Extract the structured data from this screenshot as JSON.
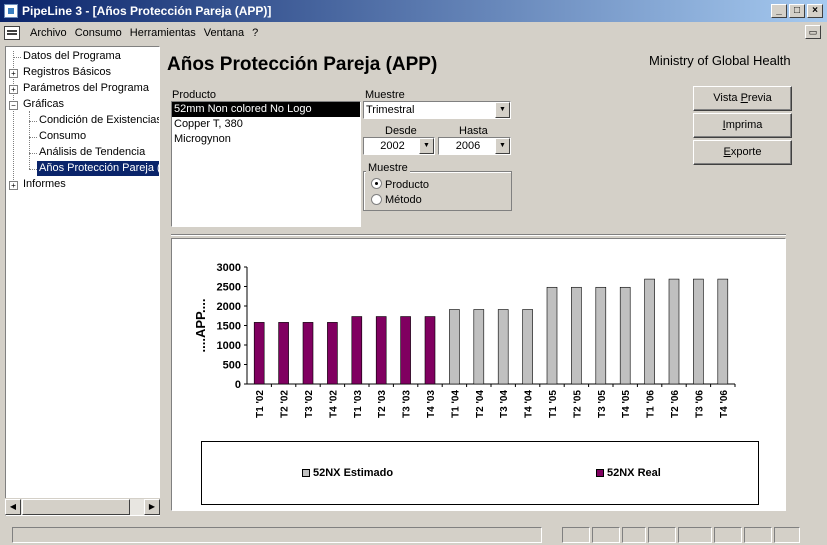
{
  "window": {
    "title": "PipeLine 3 - [Años Protección Pareja (APP)]",
    "min": "_",
    "max": "□",
    "close": "×",
    "restore": "🗗"
  },
  "menu": {
    "archivo": "Archivo",
    "consumo": "Consumo",
    "herramientas": "Herramientas",
    "ventana": "Ventana",
    "help": "?"
  },
  "tree": {
    "datos": "Datos del Programa",
    "registros": "Registros Básicos",
    "parametros": "Parámetros del Programa",
    "graficas": "Gráficas",
    "condicion": "Condición de Existencias",
    "consumo": "Consumo",
    "analisis": "Análisis de Tendencia",
    "anos": "Años Protección Pareja (APP)",
    "informes": "Informes"
  },
  "header": {
    "title": "Años Protección Pareja (APP)",
    "ministry": "Ministry of Global Health"
  },
  "producto": {
    "label": "Producto",
    "items": [
      "52mm Non colored No Logo",
      "Copper T, 380",
      "Microgynon"
    ]
  },
  "muestre": {
    "label": "Muestre",
    "value": "Trimestral"
  },
  "desde": {
    "label": "Desde",
    "value": "2002"
  },
  "hasta": {
    "label": "Hasta",
    "value": "2006"
  },
  "muestre2": {
    "label": "Muestre",
    "opt1": "Producto",
    "opt2": "Método"
  },
  "buttons": {
    "preview_pre": "Vista ",
    "preview_u": "P",
    "preview_post": "revia",
    "print_u": "I",
    "print_post": "mprima",
    "export_u": "E",
    "export_post": "xporte"
  },
  "chart_data": {
    "type": "bar",
    "ylabel": "....APP....",
    "ylim": [
      0,
      3000
    ],
    "yticks": [
      0,
      500,
      1000,
      1500,
      2000,
      2500,
      3000
    ],
    "categories": [
      "T1 '02",
      "T2 '02",
      "T3 '02",
      "T4 '02",
      "T1 '03",
      "T2 '03",
      "T3 '03",
      "T4 '03",
      "T1 '04",
      "T2 '04",
      "T3 '04",
      "T4 '04",
      "T1 '05",
      "T2 '05",
      "T3 '05",
      "T4 '05",
      "T1 '06",
      "T2 '06",
      "T3 '06",
      "T4 '06"
    ],
    "values": [
      1580,
      1580,
      1580,
      1580,
      1730,
      1730,
      1730,
      1730,
      1910,
      1910,
      1910,
      1910,
      2480,
      2480,
      2480,
      2480,
      2690,
      2690,
      2690,
      2690
    ],
    "series_of_bar": [
      "real",
      "real",
      "real",
      "real",
      "real",
      "real",
      "real",
      "real",
      "est",
      "est",
      "est",
      "est",
      "est",
      "est",
      "est",
      "est",
      "est",
      "est",
      "est",
      "est"
    ],
    "series": [
      {
        "name": "52NX Estimado",
        "color": "#c0c0c0"
      },
      {
        "name": "52NX Real",
        "color": "#800060"
      }
    ]
  }
}
